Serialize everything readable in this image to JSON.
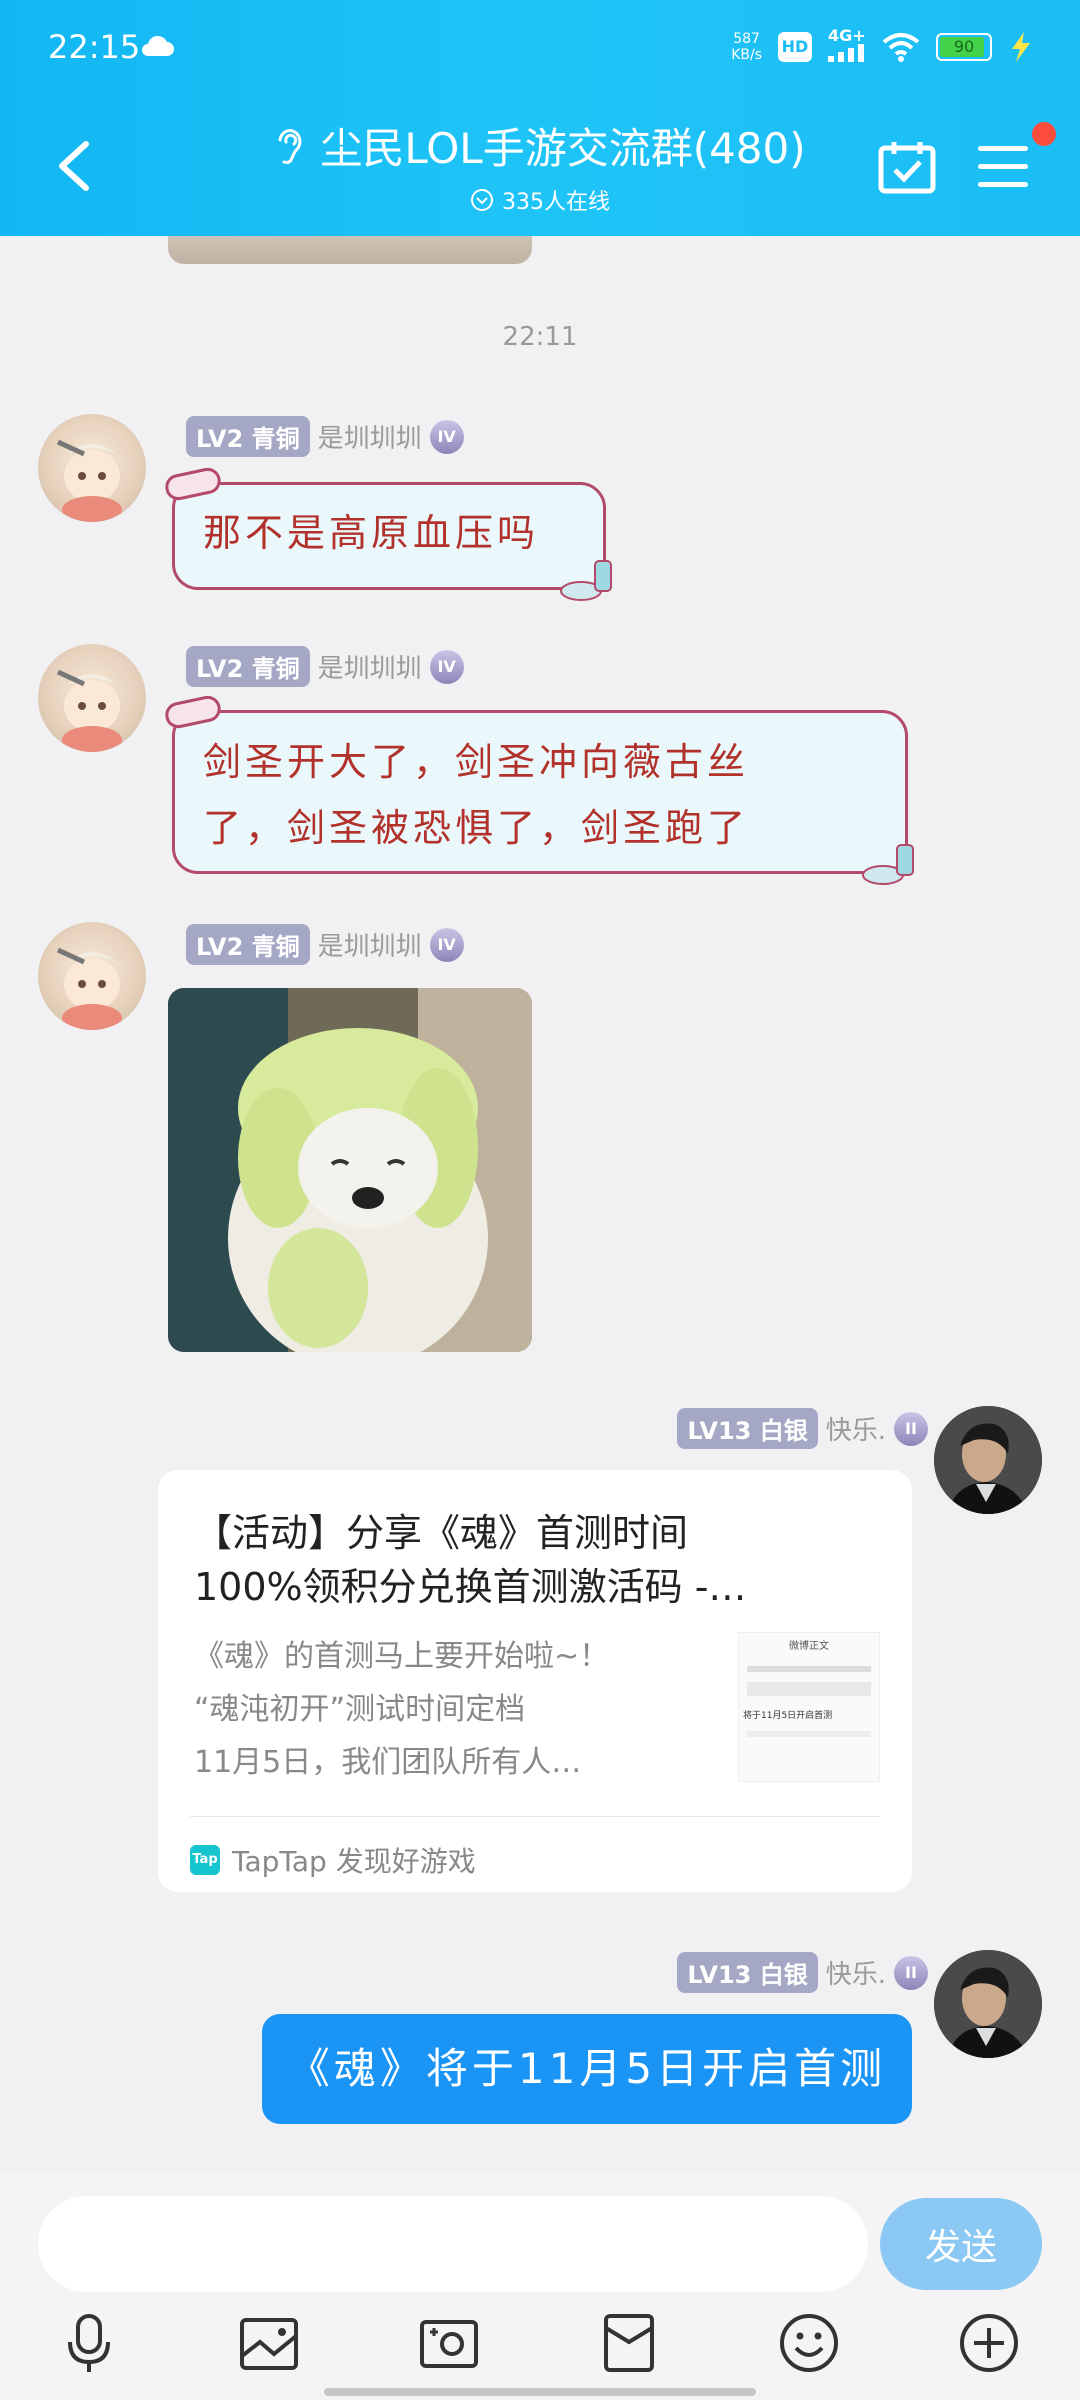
{
  "status_bar": {
    "time": "22:15",
    "net_speed_value": "587",
    "net_speed_unit": "KB/s",
    "hd_label": "HD",
    "network": "4G+",
    "battery": "90"
  },
  "header": {
    "title": "尘民LOL手游交流群(480)",
    "online": "335人在线"
  },
  "chat": {
    "timestamp": "22:11",
    "messages": [
      {
        "level": "LV2 青铜",
        "sender": "是圳圳圳",
        "rank": "IV",
        "text": "那不是高原血压吗"
      },
      {
        "level": "LV2 青铜",
        "sender": "是圳圳圳",
        "rank": "IV",
        "line1": "剑圣开大了，剑圣冲向薇古丝",
        "line2": "了，剑圣被恐惧了，剑圣跑了"
      },
      {
        "level": "LV2 青铜",
        "sender": "是圳圳圳",
        "rank": "IV"
      },
      {
        "level": "LV13 白银",
        "sender": "快乐.",
        "rank": "II",
        "share": {
          "title_line1": "【活动】分享《魂》首测时间",
          "title_line2": "100%领积分兑换首测激活码 -…",
          "desc_line1": "《魂》的首测马上要开始啦~！",
          "desc_line2": "“魂沌初开”测试时间定档",
          "desc_line3": "11月5日，我们团队所有人…",
          "thumb_title": "微博正文",
          "thumb_caption": "将于11月5日开启首测",
          "logo_text": "Tap",
          "source": "TapTap 发现好游戏"
        }
      },
      {
        "level": "LV13 白银",
        "sender": "快乐.",
        "rank": "II",
        "text": "《魂》将于11月5日开启首测"
      }
    ]
  },
  "input": {
    "placeholder": "",
    "send_label": "发送"
  }
}
